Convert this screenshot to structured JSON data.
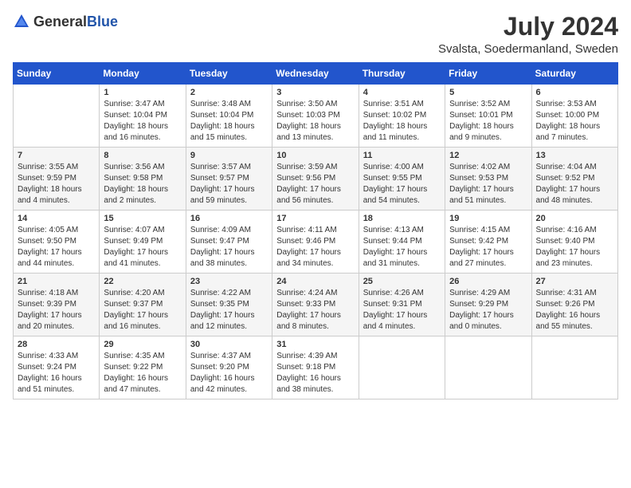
{
  "header": {
    "logo_general": "General",
    "logo_blue": "Blue",
    "month_title": "July 2024",
    "location": "Svalsta, Soedermanland, Sweden"
  },
  "weekdays": [
    "Sunday",
    "Monday",
    "Tuesday",
    "Wednesday",
    "Thursday",
    "Friday",
    "Saturday"
  ],
  "weeks": [
    [
      {
        "day": "",
        "info": ""
      },
      {
        "day": "1",
        "info": "Sunrise: 3:47 AM\nSunset: 10:04 PM\nDaylight: 18 hours\nand 16 minutes."
      },
      {
        "day": "2",
        "info": "Sunrise: 3:48 AM\nSunset: 10:04 PM\nDaylight: 18 hours\nand 15 minutes."
      },
      {
        "day": "3",
        "info": "Sunrise: 3:50 AM\nSunset: 10:03 PM\nDaylight: 18 hours\nand 13 minutes."
      },
      {
        "day": "4",
        "info": "Sunrise: 3:51 AM\nSunset: 10:02 PM\nDaylight: 18 hours\nand 11 minutes."
      },
      {
        "day": "5",
        "info": "Sunrise: 3:52 AM\nSunset: 10:01 PM\nDaylight: 18 hours\nand 9 minutes."
      },
      {
        "day": "6",
        "info": "Sunrise: 3:53 AM\nSunset: 10:00 PM\nDaylight: 18 hours\nand 7 minutes."
      }
    ],
    [
      {
        "day": "7",
        "info": "Sunrise: 3:55 AM\nSunset: 9:59 PM\nDaylight: 18 hours\nand 4 minutes."
      },
      {
        "day": "8",
        "info": "Sunrise: 3:56 AM\nSunset: 9:58 PM\nDaylight: 18 hours\nand 2 minutes."
      },
      {
        "day": "9",
        "info": "Sunrise: 3:57 AM\nSunset: 9:57 PM\nDaylight: 17 hours\nand 59 minutes."
      },
      {
        "day": "10",
        "info": "Sunrise: 3:59 AM\nSunset: 9:56 PM\nDaylight: 17 hours\nand 56 minutes."
      },
      {
        "day": "11",
        "info": "Sunrise: 4:00 AM\nSunset: 9:55 PM\nDaylight: 17 hours\nand 54 minutes."
      },
      {
        "day": "12",
        "info": "Sunrise: 4:02 AM\nSunset: 9:53 PM\nDaylight: 17 hours\nand 51 minutes."
      },
      {
        "day": "13",
        "info": "Sunrise: 4:04 AM\nSunset: 9:52 PM\nDaylight: 17 hours\nand 48 minutes."
      }
    ],
    [
      {
        "day": "14",
        "info": "Sunrise: 4:05 AM\nSunset: 9:50 PM\nDaylight: 17 hours\nand 44 minutes."
      },
      {
        "day": "15",
        "info": "Sunrise: 4:07 AM\nSunset: 9:49 PM\nDaylight: 17 hours\nand 41 minutes."
      },
      {
        "day": "16",
        "info": "Sunrise: 4:09 AM\nSunset: 9:47 PM\nDaylight: 17 hours\nand 38 minutes."
      },
      {
        "day": "17",
        "info": "Sunrise: 4:11 AM\nSunset: 9:46 PM\nDaylight: 17 hours\nand 34 minutes."
      },
      {
        "day": "18",
        "info": "Sunrise: 4:13 AM\nSunset: 9:44 PM\nDaylight: 17 hours\nand 31 minutes."
      },
      {
        "day": "19",
        "info": "Sunrise: 4:15 AM\nSunset: 9:42 PM\nDaylight: 17 hours\nand 27 minutes."
      },
      {
        "day": "20",
        "info": "Sunrise: 4:16 AM\nSunset: 9:40 PM\nDaylight: 17 hours\nand 23 minutes."
      }
    ],
    [
      {
        "day": "21",
        "info": "Sunrise: 4:18 AM\nSunset: 9:39 PM\nDaylight: 17 hours\nand 20 minutes."
      },
      {
        "day": "22",
        "info": "Sunrise: 4:20 AM\nSunset: 9:37 PM\nDaylight: 17 hours\nand 16 minutes."
      },
      {
        "day": "23",
        "info": "Sunrise: 4:22 AM\nSunset: 9:35 PM\nDaylight: 17 hours\nand 12 minutes."
      },
      {
        "day": "24",
        "info": "Sunrise: 4:24 AM\nSunset: 9:33 PM\nDaylight: 17 hours\nand 8 minutes."
      },
      {
        "day": "25",
        "info": "Sunrise: 4:26 AM\nSunset: 9:31 PM\nDaylight: 17 hours\nand 4 minutes."
      },
      {
        "day": "26",
        "info": "Sunrise: 4:29 AM\nSunset: 9:29 PM\nDaylight: 17 hours\nand 0 minutes."
      },
      {
        "day": "27",
        "info": "Sunrise: 4:31 AM\nSunset: 9:26 PM\nDaylight: 16 hours\nand 55 minutes."
      }
    ],
    [
      {
        "day": "28",
        "info": "Sunrise: 4:33 AM\nSunset: 9:24 PM\nDaylight: 16 hours\nand 51 minutes."
      },
      {
        "day": "29",
        "info": "Sunrise: 4:35 AM\nSunset: 9:22 PM\nDaylight: 16 hours\nand 47 minutes."
      },
      {
        "day": "30",
        "info": "Sunrise: 4:37 AM\nSunset: 9:20 PM\nDaylight: 16 hours\nand 42 minutes."
      },
      {
        "day": "31",
        "info": "Sunrise: 4:39 AM\nSunset: 9:18 PM\nDaylight: 16 hours\nand 38 minutes."
      },
      {
        "day": "",
        "info": ""
      },
      {
        "day": "",
        "info": ""
      },
      {
        "day": "",
        "info": ""
      }
    ]
  ]
}
